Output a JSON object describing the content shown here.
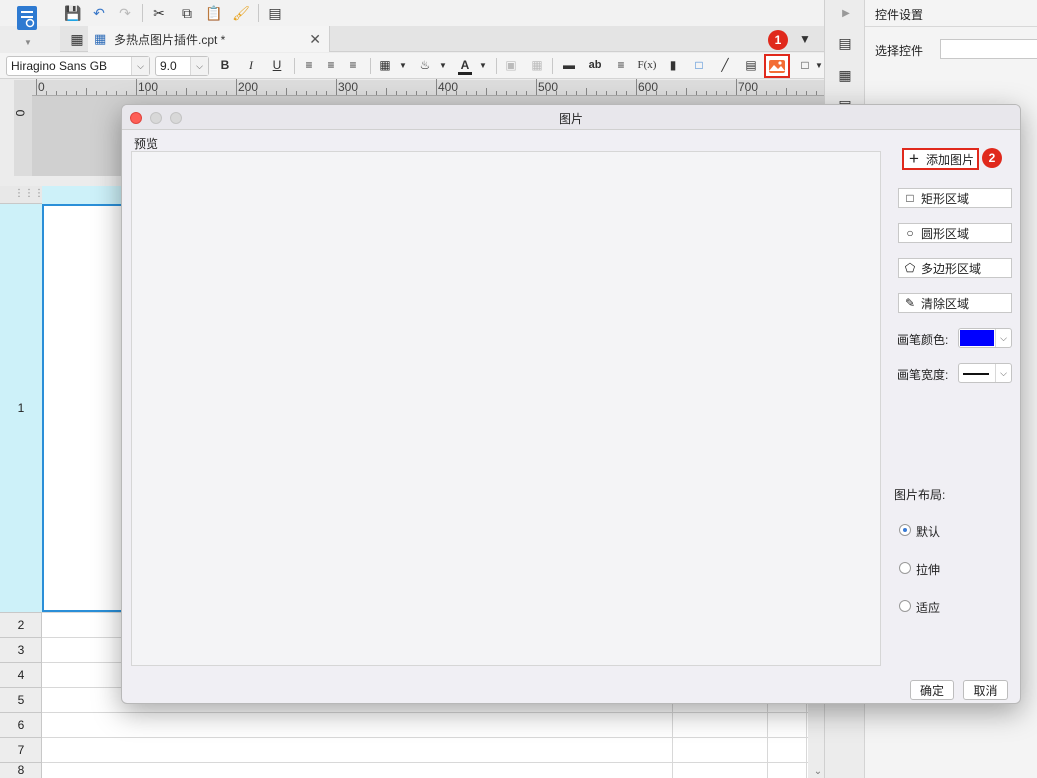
{
  "editor": {
    "file_tab_label": "多热点图片插件.cpt *",
    "font_name": "Hiragino Sans GB",
    "font_size": "9.0",
    "ruler_labels": [
      "0",
      "100",
      "200",
      "300",
      "400",
      "500",
      "600",
      "700"
    ],
    "ruler_v_label": "0",
    "row_labels": [
      "1",
      "2",
      "3",
      "4",
      "5",
      "6",
      "7",
      "8"
    ]
  },
  "right_panel": {
    "title": "控件设置",
    "select_label": "选择控件"
  },
  "badges": {
    "one": "1",
    "two": "2"
  },
  "dialog": {
    "title": "图片",
    "preview_label": "预览",
    "add_image": "添加图片",
    "rect_region": "矩形区域",
    "circle_region": "圆形区域",
    "polygon_region": "多边形区域",
    "clear_region": "清除区域",
    "pen_color_label": "画笔颜色:",
    "pen_width_label": "画笔宽度:",
    "pen_color": "#0000ff",
    "layout_label": "图片布局:",
    "layout_options": [
      "默认",
      "拉伸",
      "适应"
    ],
    "layout_selected": "默认",
    "ok": "确定",
    "cancel": "取消"
  },
  "colors": {
    "accent": "#3a78c8",
    "highlight": "#e0291c",
    "row1_header": "#cdf1f9"
  }
}
